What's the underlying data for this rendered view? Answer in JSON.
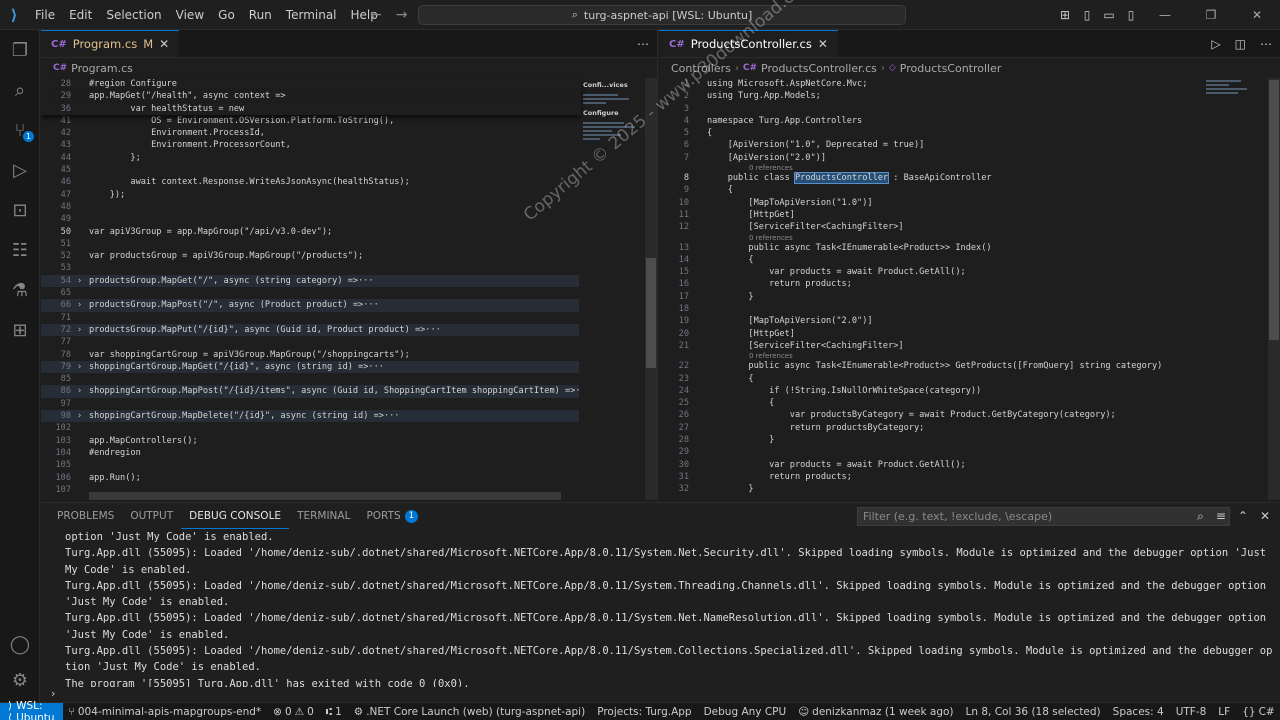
{
  "titlebar": {
    "menu": [
      "File",
      "Edit",
      "Selection",
      "View",
      "Go",
      "Run",
      "Terminal",
      "Help"
    ],
    "search": "turg-aspnet-api [WSL: Ubuntu]"
  },
  "left_editor": {
    "tab": {
      "label": "Program.cs",
      "modified": "M"
    },
    "breadcrumb": "Program.cs",
    "lines": [
      {
        "n": "28",
        "t": "#region Configure"
      },
      {
        "n": "29",
        "t": "app.MapGet(\"/health\", async context =>"
      },
      {
        "n": "36",
        "t": "        var healthStatus = new"
      },
      {
        "n": "41",
        "t": "            OS = Environment.OSVersion.Platform.ToString(),"
      },
      {
        "n": "42",
        "t": "            Environment.ProcessId,"
      },
      {
        "n": "43",
        "t": "            Environment.ProcessorCount,"
      },
      {
        "n": "44",
        "t": "        };"
      },
      {
        "n": "45",
        "t": ""
      },
      {
        "n": "46",
        "t": "        await context.Response.WriteAsJsonAsync(healthStatus);"
      },
      {
        "n": "47",
        "t": "    });"
      },
      {
        "n": "48",
        "t": ""
      },
      {
        "n": "49",
        "t": ""
      },
      {
        "n": "50",
        "t": "var apiV3Group = app.MapGroup(\"/api/v3.0-dev\");"
      },
      {
        "n": "51",
        "t": ""
      },
      {
        "n": "52",
        "t": "var productsGroup = apiV3Group.MapGroup(\"/products\");"
      },
      {
        "n": "53",
        "t": ""
      },
      {
        "n": "54",
        "t": "productsGroup.MapGet(\"/\", async (string category) =>···"
      },
      {
        "n": "65",
        "t": ""
      },
      {
        "n": "66",
        "t": "productsGroup.MapPost(\"/\", async (Product product) =>···"
      },
      {
        "n": "71",
        "t": ""
      },
      {
        "n": "72",
        "t": "productsGroup.MapPut(\"/{id}\", async (Guid id, Product product) =>···"
      },
      {
        "n": "77",
        "t": ""
      },
      {
        "n": "78",
        "t": "var shoppingCartGroup = apiV3Group.MapGroup(\"/shoppingcarts\");"
      },
      {
        "n": "79",
        "t": "shoppingCartGroup.MapGet(\"/{id}\", async (string id) =>···"
      },
      {
        "n": "85",
        "t": ""
      },
      {
        "n": "86",
        "t": "shoppingCartGroup.MapPost(\"/{id}/items\", async (Guid id, ShoppingCartItem shoppingCartItem) =>···"
      },
      {
        "n": "97",
        "t": ""
      },
      {
        "n": "98",
        "t": "shoppingCartGroup.MapDelete(\"/{id}\", async (string id) =>···"
      },
      {
        "n": "102",
        "t": ""
      },
      {
        "n": "103",
        "t": "app.MapControllers();"
      },
      {
        "n": "104",
        "t": "#endregion"
      },
      {
        "n": "105",
        "t": ""
      },
      {
        "n": "106",
        "t": "app.Run();"
      },
      {
        "n": "107",
        "t": ""
      }
    ],
    "minimap_labels": [
      "Confi...vices",
      "Configure"
    ]
  },
  "right_editor": {
    "tab": {
      "label": "ProductsController.cs"
    },
    "breadcrumb": [
      "Controllers",
      "ProductsController.cs",
      "ProductsController"
    ],
    "lines": [
      {
        "n": "1",
        "t": "using Microsoft.AspNetCore.Mvc;"
      },
      {
        "n": "2",
        "t": "using Turg.App.Models;"
      },
      {
        "n": "3",
        "t": ""
      },
      {
        "n": "4",
        "t": "namespace Turg.App.Controllers"
      },
      {
        "n": "5",
        "t": "{"
      },
      {
        "n": "6",
        "t": "    [ApiVersion(\"1.0\", Deprecated = true)]"
      },
      {
        "n": "7",
        "t": "    [ApiVersion(\"2.0\")]",
        "ref": "0 references"
      },
      {
        "n": "8",
        "t": "    public class ProductsController : BaseApiController"
      },
      {
        "n": "9",
        "t": "    {"
      },
      {
        "n": "10",
        "t": "        [MapToApiVersion(\"1.0\")]"
      },
      {
        "n": "11",
        "t": "        [HttpGet]"
      },
      {
        "n": "12",
        "t": "        [ServiceFilter<CachingFilter>]",
        "ref": "0 references"
      },
      {
        "n": "13",
        "t": "        public async Task<IEnumerable<Product>> Index()"
      },
      {
        "n": "14",
        "t": "        {"
      },
      {
        "n": "15",
        "t": "            var products = await Product.GetAll();"
      },
      {
        "n": "16",
        "t": "            return products;"
      },
      {
        "n": "17",
        "t": "        }"
      },
      {
        "n": "18",
        "t": ""
      },
      {
        "n": "19",
        "t": "        [MapToApiVersion(\"2.0\")]"
      },
      {
        "n": "20",
        "t": "        [HttpGet]"
      },
      {
        "n": "21",
        "t": "        [ServiceFilter<CachingFilter>]",
        "ref": "0 references"
      },
      {
        "n": "22",
        "t": "        public async Task<IEnumerable<Product>> GetProducts([FromQuery] string category)"
      },
      {
        "n": "23",
        "t": "        {"
      },
      {
        "n": "24",
        "t": "            if (!String.IsNullOrWhiteSpace(category))"
      },
      {
        "n": "25",
        "t": "            {"
      },
      {
        "n": "26",
        "t": "                var productsByCategory = await Product.GetByCategory(category);"
      },
      {
        "n": "27",
        "t": "                return productsByCategory;"
      },
      {
        "n": "28",
        "t": "            }"
      },
      {
        "n": "29",
        "t": ""
      },
      {
        "n": "30",
        "t": "            var products = await Product.GetAll();"
      },
      {
        "n": "31",
        "t": "            return products;"
      },
      {
        "n": "32",
        "t": "        }"
      }
    ]
  },
  "watermark": "Copyright © 2025 - www.p30download.com",
  "panel": {
    "tabs": [
      "Problems",
      "Output",
      "Debug Console",
      "Terminal",
      "Ports"
    ],
    "ports_badge": "1",
    "filter_placeholder": "Filter (e.g. text, !exclude, \\escape)",
    "console": [
      "option 'Just My Code' is enabled.",
      "Turg.App.dll (55095): Loaded '/home/deniz-sub/.dotnet/shared/Microsoft.NETCore.App/8.0.11/System.Net.Security.dll'. Skipped loading symbols. Module is optimized and the debugger option 'Just My Code' is enabled.",
      "Turg.App.dll (55095): Loaded '/home/deniz-sub/.dotnet/shared/Microsoft.NETCore.App/8.0.11/System.Threading.Channels.dll'. Skipped loading symbols. Module is optimized and the debugger option 'Just My Code' is enabled.",
      "Turg.App.dll (55095): Loaded '/home/deniz-sub/.dotnet/shared/Microsoft.NETCore.App/8.0.11/System.Net.NameResolution.dll'. Skipped loading symbols. Module is optimized and the debugger option 'Just My Code' is enabled.",
      "Turg.App.dll (55095): Loaded '/home/deniz-sub/.dotnet/shared/Microsoft.NETCore.App/8.0.11/System.Collections.Specialized.dll'. Skipped loading symbols. Module is optimized and the debugger option 'Just My Code' is enabled.",
      "The program '[55095] Turg.App.dll' has exited with code 0 (0x0)."
    ]
  },
  "statusbar": {
    "remote": "WSL: Ubuntu",
    "branch": "004-minimal-apis-mapgroups-end*",
    "errors": "0",
    "warnings": "0",
    "info": "1",
    "launch": ".NET Core Launch (web) (turg-aspnet-api)",
    "projects": "Projects: Turg.App",
    "debug": "Debug Any CPU",
    "author": "denizkanmaz (1 week ago)",
    "position": "Ln 8, Col 36 (18 selected)",
    "spaces": "Spaces: 4",
    "encoding": "UTF-8",
    "eol": "LF",
    "language": "C#"
  },
  "colors": {
    "accent": "#0078d4",
    "background": "#1e1e1e",
    "panel": "#1f1f1f"
  }
}
